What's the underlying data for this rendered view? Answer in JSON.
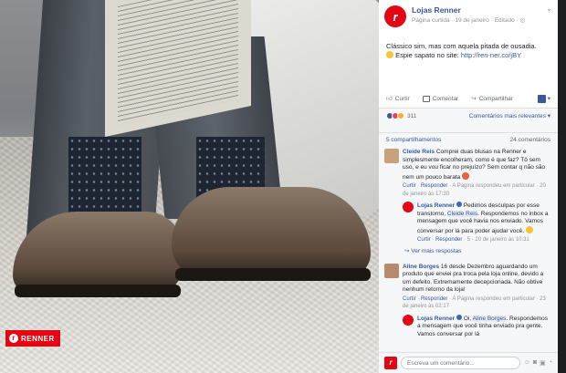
{
  "photo": {
    "logo_text": "RENNER",
    "logo_mark": "r"
  },
  "post": {
    "page_name": "Lojas Renner",
    "meta": "Página curtida · 19 de janeiro · Editado · ",
    "avatar_letter": "r",
    "caption_line1": "Clássico sim, mas com aquela pitada de ousadia.",
    "caption_line2_prefix": "Espie sapato no site: ",
    "caption_link": "http://ren-ner.co/jBY"
  },
  "actions": {
    "like": "Curtir",
    "comment": "Comentar",
    "share": "Compartilhar"
  },
  "reactions": {
    "count": "311",
    "sort_label": "Comentários mais relevantes ▾",
    "colors": [
      "#3b5998",
      "#f33e58",
      "#f7b125"
    ]
  },
  "shares": {
    "shares_label": "5 compartilhamentos",
    "comments_label": "24 comentários"
  },
  "comments": [
    {
      "name": "Cleide Reis",
      "text": "Comprei duas blusas na Renner e simplesmente encolheram, como é que faz? Tô sem uso, e eu vou ficar no prejuízo? Sem contar q não são nem um pouco barata",
      "links": [
        "Curtir",
        "Responder"
      ],
      "info": "· A Página respondeu em particular · 20 de janeiro às 17:30"
    },
    {
      "name": "Aline Borges",
      "text": "16 desde Dezembro aguardando um produto que enviei pra troca pela loja online, devido a um defeito. Extremamente decepcionada. Não obtive nenhum retorno da loja!",
      "links": [
        "Curtir",
        "Responder"
      ],
      "info": "· A Página respondeu em particular · 23 de janeiro às 02:17"
    }
  ],
  "replies": [
    {
      "name": "Lojas Renner",
      "text_before_tag": "Pedimos desculpas por esse transtorno, ",
      "tag": "Cleide Reis",
      "text_after_tag": ". Respondemos no inbox a mensagem que você havia nos enviado. Vamos conversar por lá para poder ajudar você.",
      "links": [
        "Curtir",
        "Responder"
      ],
      "info": "· 5 · 20 de janeiro às 10:31"
    },
    {
      "name": "Lojas Renner",
      "text_before_tag": "Oi, ",
      "tag": "Aline Borges",
      "text_after_tag": ". Respondemos a mensagem que você tinha enviado pra gente. Vamos conversar por lá",
      "links": [],
      "info": ""
    }
  ],
  "more_replies": "↪ Ver mais respostas",
  "composer": {
    "placeholder": "Escreva um comentário..."
  }
}
